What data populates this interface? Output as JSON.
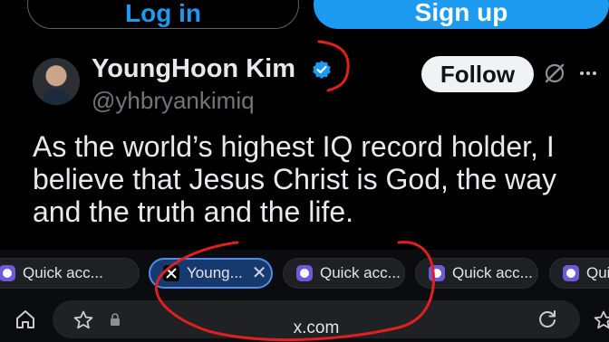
{
  "auth": {
    "login_label": "Log in",
    "signup_label": "Sign up"
  },
  "post": {
    "display_name": "YoungHoon Kim",
    "handle": "@yhbryankimiq",
    "follow_label": "Follow",
    "text": "As the world’s highest IQ record holder, I believe that Jesus Christ is God, the way and the truth and the life.",
    "verified_color": "#1d9bf0"
  },
  "tabs": [
    {
      "label": "Quick acc...",
      "icon": "quick-access-icon",
      "active": false
    },
    {
      "label": "Young...",
      "icon": "x-logo-icon",
      "active": true
    },
    {
      "label": "Quick acc...",
      "icon": "quick-access-icon",
      "active": false
    },
    {
      "label": "Quick acc...",
      "icon": "quick-access-icon",
      "active": false
    },
    {
      "label": "Quic",
      "icon": "quick-access-icon",
      "active": false
    }
  ],
  "address_bar": {
    "url": "x.com"
  },
  "colors": {
    "accent": "#1d9bf0",
    "annotation": "#e0201f",
    "active_tab": "#173a6e"
  }
}
